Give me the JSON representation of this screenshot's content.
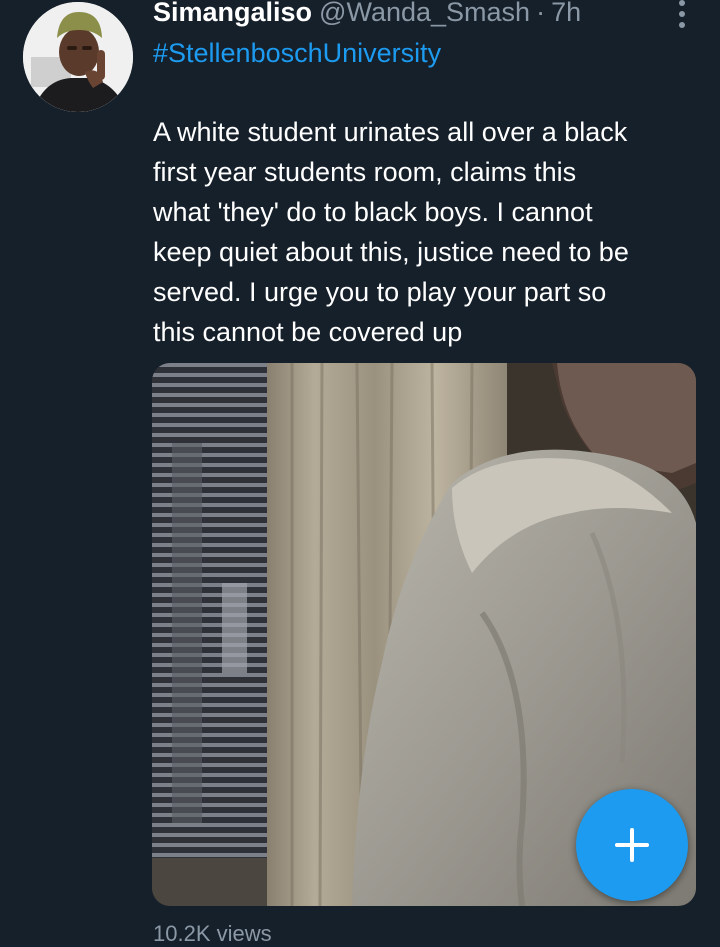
{
  "tweet": {
    "author_name": "Simangaliso",
    "author_handle": "@Wanda_Smash",
    "separator": "·",
    "time": "7h",
    "hashtag": "#StellenboschUniversity",
    "text_lines": [
      "A white student urinates all over a black",
      "first year students room, claims this",
      "what 'they' do to black boys. I cannot",
      "keep quiet about this, justice need to be",
      "served. I urge you to play your part so",
      "this cannot be covered up"
    ],
    "views_partial": "10.2K views"
  },
  "icons": {
    "more": "more-vertical-icon",
    "compose": "plus-icon"
  },
  "colors": {
    "background": "#15202b",
    "link": "#1d9bf0",
    "secondary_text": "#8b98a5",
    "fab": "#1d9bf0"
  }
}
